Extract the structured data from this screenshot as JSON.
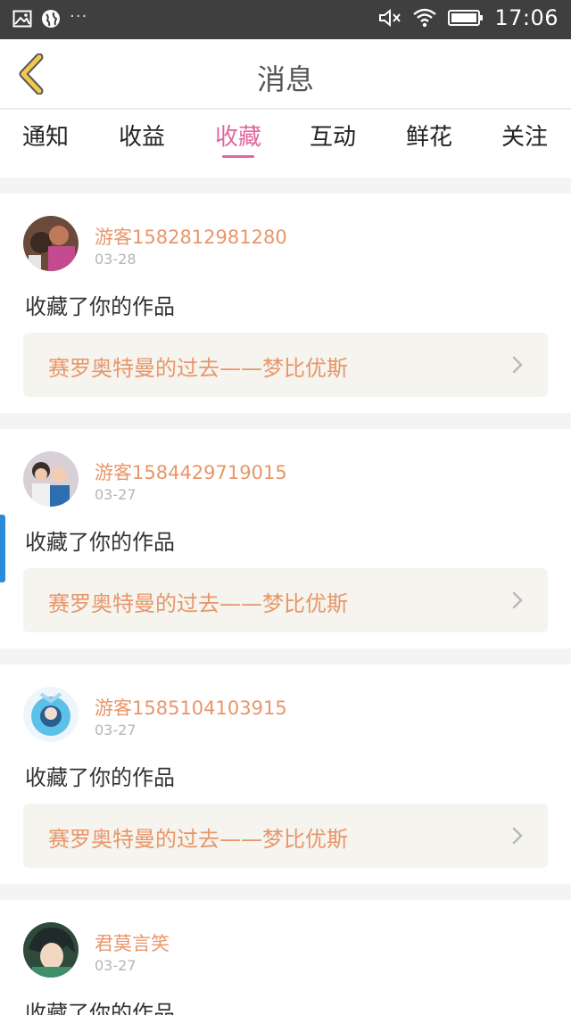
{
  "status_bar": {
    "time": "17:06",
    "left_icons": [
      "image-icon",
      "globe-icon",
      "more-dots-icon"
    ],
    "right_icons": [
      "mute-icon",
      "wifi-icon",
      "battery-icon"
    ],
    "more": "···"
  },
  "header": {
    "title": "消息",
    "back_icon": "chevron-left-icon",
    "back_color": "#f2c94c"
  },
  "tabs": [
    {
      "label": "通知",
      "active": false
    },
    {
      "label": "收益",
      "active": false
    },
    {
      "label": "收藏",
      "active": true
    },
    {
      "label": "互动",
      "active": false
    },
    {
      "label": "鲜花",
      "active": false
    },
    {
      "label": "关注",
      "active": false
    }
  ],
  "accent_color": "#e0679e",
  "name_color": "#e8966a",
  "messages": [
    {
      "username": "游客1582812981280",
      "date": "03-28",
      "action": "收藏了你的作品",
      "work_title": "赛罗奥特曼的过去——梦比优斯",
      "avatar_icon": "user-avatar-photo"
    },
    {
      "username": "游客1584429719015",
      "date": "03-27",
      "action": "收藏了你的作品",
      "work_title": "赛罗奥特曼的过去——梦比优斯",
      "avatar_icon": "user-avatar-photo"
    },
    {
      "username": "游客1585104103915",
      "date": "03-27",
      "action": "收藏了你的作品",
      "work_title": "赛罗奥特曼的过去——梦比优斯",
      "avatar_icon": "user-avatar-anime"
    },
    {
      "username": "君莫言笑",
      "date": "03-27",
      "action": "收藏了你的作品",
      "work_title": "",
      "avatar_icon": "user-avatar-anime"
    }
  ]
}
